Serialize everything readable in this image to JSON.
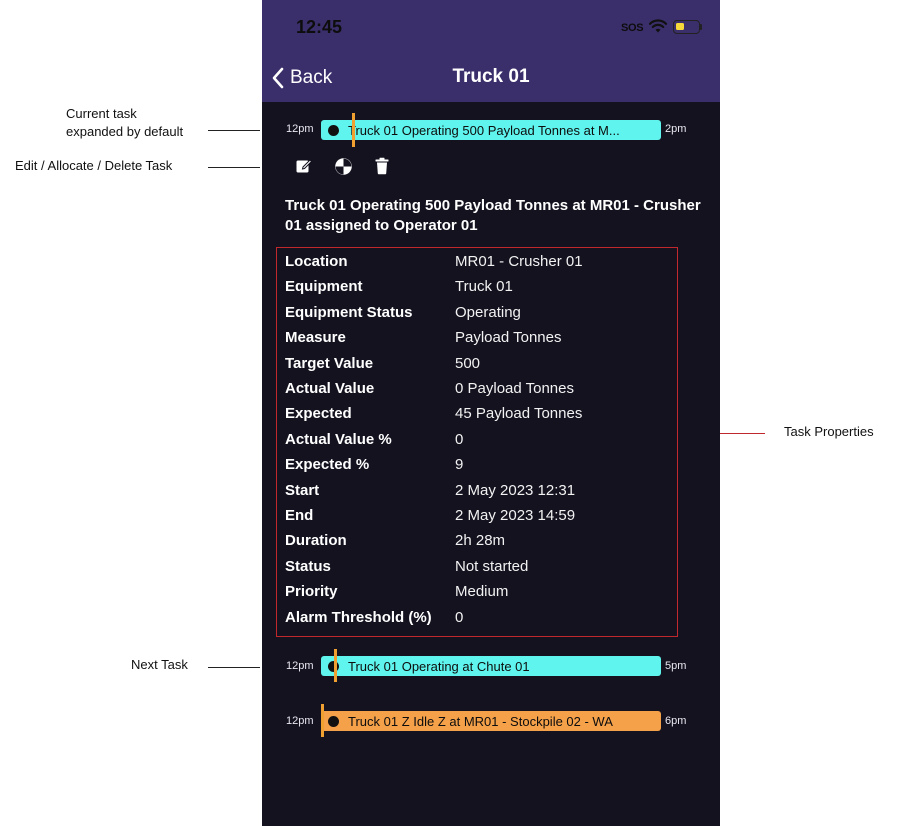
{
  "annotations": {
    "current_task_line1": "Current task",
    "current_task_line2": "expanded by default",
    "edit_actions": "Edit / Allocate / Delete Task",
    "next_task": "Next Task",
    "task_properties": "Task Properties"
  },
  "status_bar": {
    "time": "12:45",
    "sos": "SOS"
  },
  "header": {
    "back_label": "Back",
    "title": "Truck 01"
  },
  "current_task": {
    "start_label": "12pm",
    "end_label": "2pm",
    "bar_text": "Truck 01 Operating 500 Payload Tonnes at M...",
    "full_title": "Truck 01 Operating 500 Payload Tonnes at MR01 - Crusher 01 assigned to Operator 01",
    "properties": [
      {
        "key": "Location",
        "value": "MR01 - Crusher 01"
      },
      {
        "key": "Equipment",
        "value": "Truck 01"
      },
      {
        "key": "Equipment Status",
        "value": "Operating"
      },
      {
        "key": "Measure",
        "value": "Payload Tonnes"
      },
      {
        "key": "Target Value",
        "value": "500"
      },
      {
        "key": "Actual Value",
        "value": "0 Payload Tonnes"
      },
      {
        "key": "Expected",
        "value": "45 Payload Tonnes"
      },
      {
        "key": "Actual Value %",
        "value": "0"
      },
      {
        "key": "Expected %",
        "value": "9"
      },
      {
        "key": "Start",
        "value": "2 May 2023 12:31"
      },
      {
        "key": "End",
        "value": "2 May 2023 14:59"
      },
      {
        "key": "Duration",
        "value": "2h 28m"
      },
      {
        "key": "Status",
        "value": "Not started"
      },
      {
        "key": "Priority",
        "value": "Medium"
      },
      {
        "key": "Alarm Threshold (%)",
        "value": "0"
      }
    ]
  },
  "next_tasks": [
    {
      "start_label": "12pm",
      "end_label": "5pm",
      "bar_text": "Truck 01 Operating at Chute 01"
    },
    {
      "start_label": "12pm",
      "end_label": "6pm",
      "bar_text": "Truck 01 Z Idle Z at MR01 - Stockpile 02 - WA"
    }
  ],
  "colors": {
    "header_bg": "#3b2f6b",
    "screen_bg": "#14121f",
    "operating_bar": "#5ff5ee",
    "idle_bar": "#f5a14a",
    "properties_border": "#c0282e",
    "annotation_line": "#222222"
  },
  "icons": [
    "chevron-left-icon",
    "edit-icon",
    "allocate-icon",
    "trash-icon",
    "wifi-icon",
    "battery-icon"
  ]
}
